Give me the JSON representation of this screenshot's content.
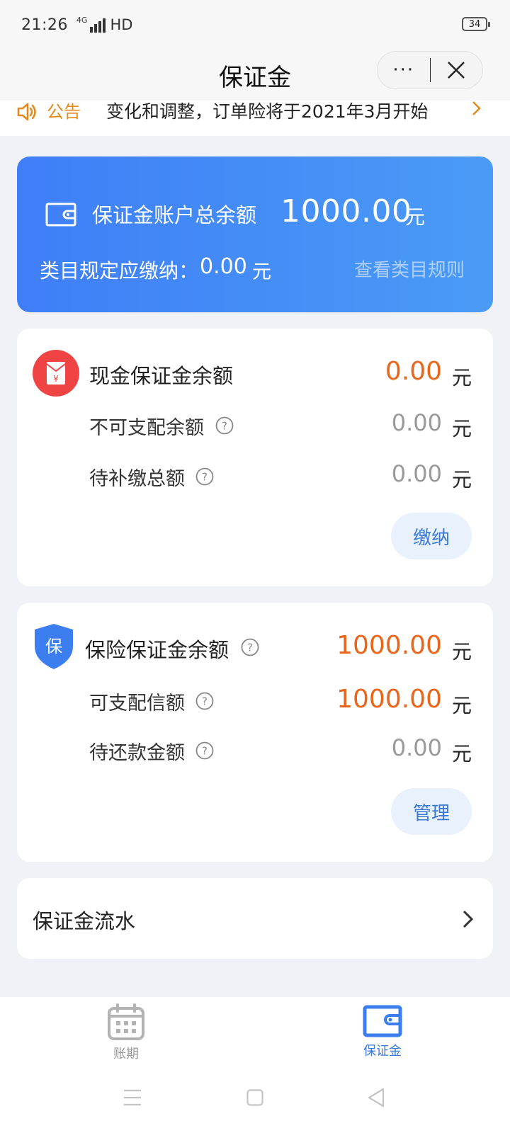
{
  "status_bar": {
    "time": "21:26",
    "network": "4G",
    "hd": "HD",
    "battery": "34"
  },
  "nav": {
    "title": "保证金",
    "more": "···"
  },
  "notice": {
    "label": "公告",
    "text": "变化和调整，订单险将于2021年3月开始"
  },
  "summary": {
    "total_label": "保证金账户总余额",
    "total_amount": "1000.00",
    "total_unit": "元",
    "required_label": "类目规定应缴纳：",
    "required_amount": "0.00",
    "required_unit": "元",
    "rules_link": "查看类目规则"
  },
  "cash": {
    "icon_char": "¥",
    "title": "现金保证金余额",
    "amount": "0.00",
    "unit": "元",
    "rows": [
      {
        "label": "不可支配余额",
        "amount": "0.00",
        "unit": "元"
      },
      {
        "label": "待补缴总额",
        "amount": "0.00",
        "unit": "元"
      }
    ],
    "button": "缴纳"
  },
  "insurance": {
    "icon_char": "保",
    "title": "保险保证金余额",
    "amount": "1000.00",
    "unit": "元",
    "rows": [
      {
        "label": "可支配信额",
        "amount": "1000.00",
        "unit": "元"
      },
      {
        "label": "待还款金额",
        "amount": "0.00",
        "unit": "元"
      }
    ],
    "button": "管理"
  },
  "flow": {
    "label": "保证金流水"
  },
  "tabs": [
    {
      "label": "账期",
      "active": false,
      "icon": "calendar-icon"
    },
    {
      "label": "保证金",
      "active": true,
      "icon": "wallet-icon"
    }
  ],
  "colors": {
    "accent": "#3a78d6",
    "orange": "#e8651a",
    "card_blue": "#4289f7",
    "red": "#f04444"
  }
}
